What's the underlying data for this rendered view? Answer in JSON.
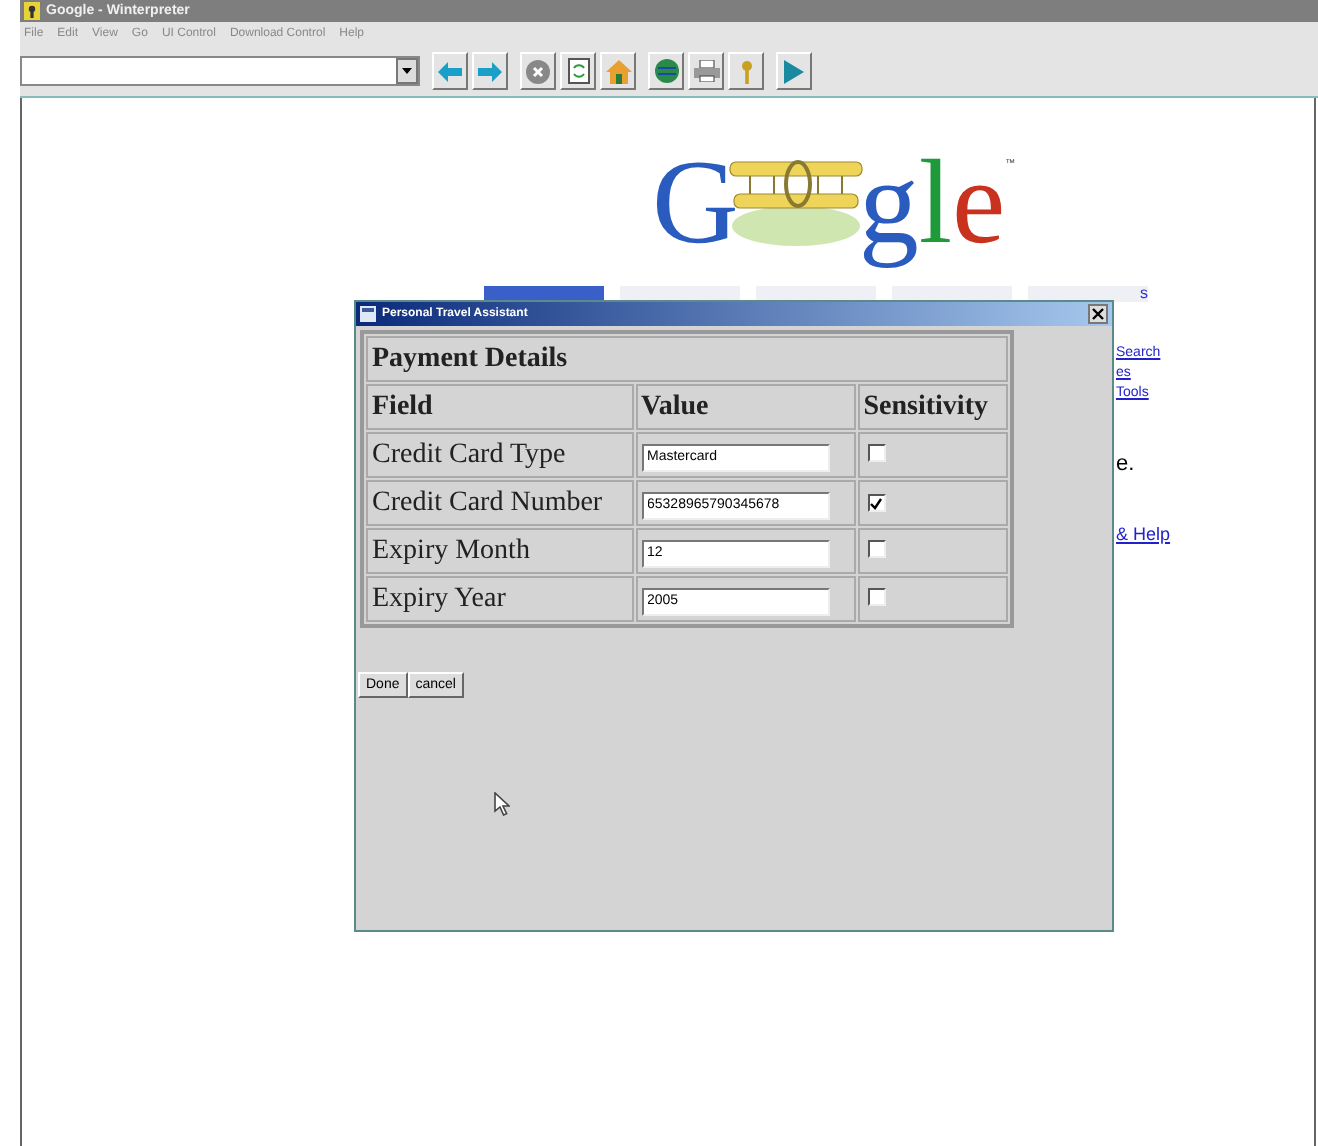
{
  "window": {
    "title": "Google - Winterpreter"
  },
  "menu": [
    "File",
    "Edit",
    "View",
    "Go",
    "UI Control",
    "Download Control",
    "Help"
  ],
  "page": {
    "logo": {
      "letters": [
        {
          "text": "G",
          "color": "#2a5bbf"
        },
        {
          "text": "g",
          "color": "#2a5bbf"
        },
        {
          "text": "l",
          "color": "#1f9a3a"
        },
        {
          "text": "e",
          "color": "#c8321e"
        }
      ],
      "trademark": "™"
    },
    "tabs": [
      {
        "selected": true
      },
      {
        "selected": false
      },
      {
        "selected": false
      },
      {
        "selected": false
      },
      {
        "label": "s",
        "selected": false
      }
    ],
    "link_fragments": [
      "Search",
      "es",
      "Tools"
    ],
    "text_fragment": "e.",
    "help_fragment": "& Help"
  },
  "dialog": {
    "title": "Personal Travel Assistant",
    "heading": "Payment Details",
    "columns": [
      "Field",
      "Value",
      "Sensitivity"
    ],
    "rows": [
      {
        "field": "Credit Card Type",
        "value": "Mastercard",
        "sensitive": false
      },
      {
        "field": "Credit Card Number",
        "value": "65328965790345678",
        "sensitive": true
      },
      {
        "field": "Expiry Month",
        "value": "12",
        "sensitive": false
      },
      {
        "field": "Expiry Year",
        "value": "2005",
        "sensitive": false
      }
    ],
    "buttons": [
      "Done",
      "cancel"
    ]
  }
}
